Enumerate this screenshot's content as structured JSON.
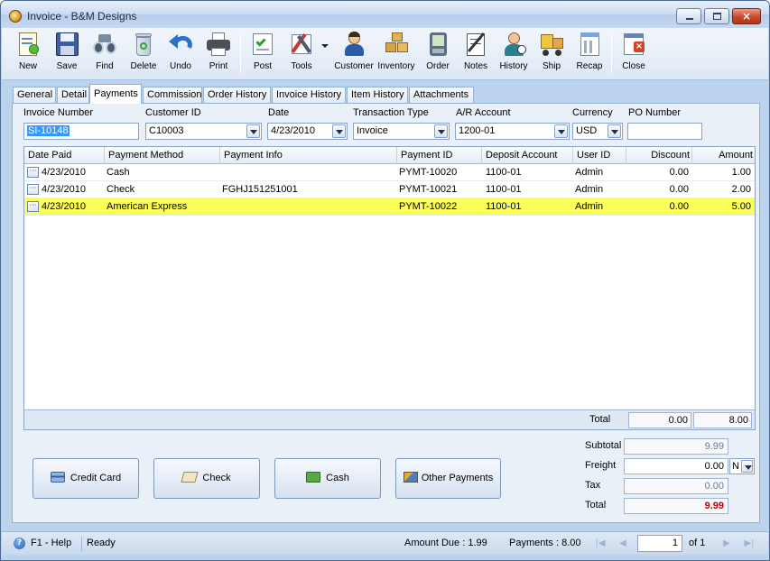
{
  "window": {
    "title": "Invoice - B&M Designs",
    "close_glyph": "×"
  },
  "toolbar": [
    {
      "label": "New",
      "icon": "new-icon"
    },
    {
      "label": "Save",
      "icon": "save-icon"
    },
    {
      "label": "Find",
      "icon": "binoculars-icon"
    },
    {
      "label": "Delete",
      "icon": "recycle-bin-icon"
    },
    {
      "label": "Undo",
      "icon": "undo-icon"
    },
    {
      "label": "Print",
      "icon": "printer-icon"
    },
    {
      "label": "Post",
      "icon": "post-icon"
    },
    {
      "label": "Tools",
      "icon": "tools-icon"
    },
    {
      "label": "Customer",
      "icon": "customer-icon"
    },
    {
      "label": "Inventory",
      "icon": "inventory-icon"
    },
    {
      "label": "Order",
      "icon": "order-icon"
    },
    {
      "label": "Notes",
      "icon": "notes-icon"
    },
    {
      "label": "History",
      "icon": "history-icon"
    },
    {
      "label": "Ship",
      "icon": "ship-icon"
    },
    {
      "label": "Recap",
      "icon": "recap-icon"
    },
    {
      "label": "Close",
      "icon": "close-form-icon"
    }
  ],
  "tabs": [
    "General",
    "Detail",
    "Payments",
    "Commission",
    "Order History",
    "Invoice History",
    "Item History",
    "Attachments"
  ],
  "active_tab": "Payments",
  "header": {
    "invoice_number": {
      "label": "Invoice Number",
      "value": "SI-10148"
    },
    "customer_id": {
      "label": "Customer ID",
      "value": "C10003"
    },
    "date": {
      "label": "Date",
      "value": "4/23/2010"
    },
    "transaction_type": {
      "label": "Transaction Type",
      "value": "Invoice"
    },
    "ar_account": {
      "label": "A/R Account",
      "value": "1200-01"
    },
    "currency": {
      "label": "Currency",
      "value": "USD"
    },
    "po_number": {
      "label": "PO Number",
      "value": ""
    }
  },
  "grid": {
    "columns": [
      "Date Paid",
      "Payment Method",
      "Payment Info",
      "Payment ID",
      "Deposit Account",
      "User ID",
      "Discount",
      "Amount"
    ],
    "rows": [
      {
        "date": "4/23/2010",
        "method": "Cash",
        "info": "",
        "id": "PYMT-10020",
        "account": "1100-01",
        "user": "Admin",
        "discount": "0.00",
        "amount": "1.00"
      },
      {
        "date": "4/23/2010",
        "method": "Check",
        "info": "FGHJ151251001",
        "id": "PYMT-10021",
        "account": "1100-01",
        "user": "Admin",
        "discount": "0.00",
        "amount": "2.00"
      },
      {
        "date": "4/23/2010",
        "method": "American Express",
        "info": "",
        "id": "PYMT-10022",
        "account": "1100-01",
        "user": "Admin",
        "discount": "0.00",
        "amount": "5.00"
      }
    ],
    "highlighted_row": 2,
    "ellipsis_glyph": "···",
    "total_label": "Total",
    "total_discount": "0.00",
    "total_amount": "8.00"
  },
  "payment_buttons": {
    "credit_card": "Credit Card",
    "check": "Check",
    "cash": "Cash",
    "other": "Other Payments"
  },
  "summary": {
    "subtotal": {
      "label": "Subtotal",
      "value": "9.99"
    },
    "freight": {
      "label": "Freight",
      "value": "0.00",
      "code": "N"
    },
    "tax": {
      "label": "Tax",
      "value": "0.00"
    },
    "total": {
      "label": "Total",
      "value": "9.99"
    }
  },
  "status": {
    "help": "F1 - Help",
    "help_glyph": "?",
    "state": "Ready",
    "amount_due": "Amount Due : 1.99",
    "payments": "Payments : 8.00",
    "page": "1",
    "of": "of  1"
  },
  "colors": {
    "highlight_row": "#fbff57",
    "total_red": "#c00000",
    "window_chrome": "#bcd3ee"
  }
}
